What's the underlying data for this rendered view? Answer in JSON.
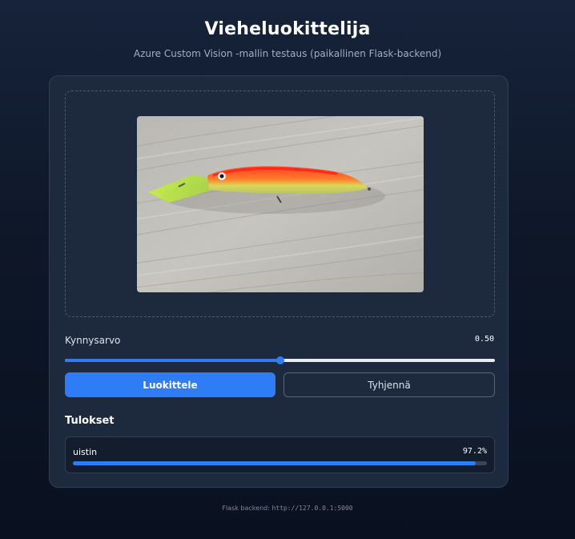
{
  "header": {
    "title": "Vieheluokittelija",
    "subtitle": "Azure Custom Vision -mallin testaus (paikallinen Flask-backend)"
  },
  "upload": {
    "preview_icon": "fishing-lure-photo"
  },
  "threshold": {
    "label": "Kynnysarvo",
    "value_text": "0.50",
    "value": 0.5,
    "min": 0,
    "max": 1
  },
  "actions": {
    "classify_label": "Luokittele",
    "clear_label": "Tyhjennä"
  },
  "results": {
    "heading": "Tulokset",
    "items": [
      {
        "label": "uistin",
        "probability_text": "97.2%",
        "probability": 0.972
      }
    ]
  },
  "footer": {
    "prefix": "Flask backend:",
    "url": "http://127.0.0.1:5000"
  },
  "colors": {
    "accent": "#2f7df6",
    "card_background": "#1d2a3e",
    "page_background": "#0e1728"
  }
}
